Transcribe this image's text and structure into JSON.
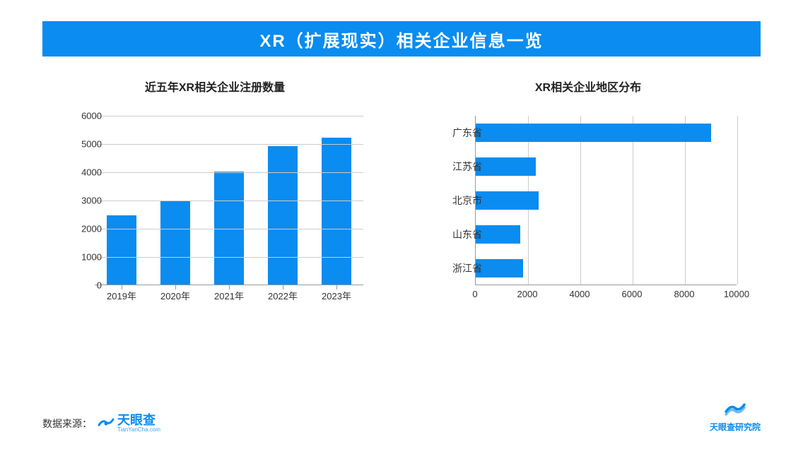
{
  "title": "XR（扩展现实）相关企业信息一览",
  "source_label": "数据来源：",
  "logo_text": "天眼查",
  "logo_sub": "TianYanCha.com",
  "institute_text": "天眼查研究院",
  "chart_data": [
    {
      "type": "bar",
      "orientation": "vertical",
      "title": "近五年XR相关企业注册数量",
      "categories": [
        "2019年",
        "2020年",
        "2021年",
        "2022年",
        "2023年"
      ],
      "values": [
        2450,
        2950,
        4000,
        4900,
        5200
      ],
      "ylim": [
        0,
        6000
      ],
      "ystep": 1000,
      "xlabel": "",
      "ylabel": ""
    },
    {
      "type": "bar",
      "orientation": "horizontal",
      "title": "XR相关企业地区分布",
      "categories": [
        "广东省",
        "江苏省",
        "北京市",
        "山东省",
        "浙江省"
      ],
      "values": [
        9000,
        2300,
        2400,
        1700,
        1800
      ],
      "xlim": [
        0,
        10000
      ],
      "xstep": 2000,
      "xlabel": "",
      "ylabel": ""
    }
  ]
}
